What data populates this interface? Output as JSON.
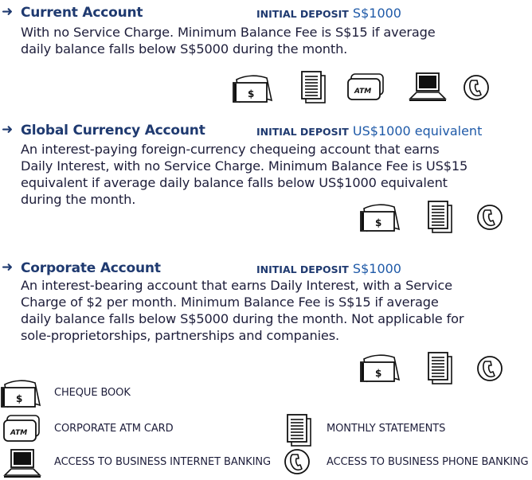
{
  "accounts": [
    {
      "name": "Current Account",
      "deposit_label": "INITIAL DEPOSIT",
      "deposit_value": "S$1000",
      "lines": [
        "With no Service Charge. Minimum Balance Fee is S$15 if average",
        "daily balance falls below S$5000 during the month."
      ],
      "icons": [
        "cheque-book-icon",
        "monthly-statement-icon",
        "atm-card-icon",
        "internet-banking-icon",
        "phone-banking-icon"
      ]
    },
    {
      "name": "Global Currency Account",
      "deposit_label": "INITIAL DEPOSIT",
      "deposit_value": "US$1000 equivalent",
      "lines": [
        "An interest-paying foreign-currency chequeing account that earns",
        "Daily Interest, with no Service Charge. Minimum Balance Fee is US$15",
        "equivalent if average daily balance falls below US$1000 equivalent",
        "during the month."
      ],
      "icons": [
        "cheque-book-icon",
        "monthly-statement-icon",
        "phone-banking-icon"
      ]
    },
    {
      "name": "Corporate Account",
      "deposit_label": "INITIAL DEPOSIT",
      "deposit_value": "S$1000",
      "lines": [
        "An interest-bearing account that earns Daily Interest, with a Service",
        "Charge of $2 per month. Minimum Balance Fee is S$15 if average",
        "daily balance falls below S$5000 during the month. Not applicable for",
        "sole-proprietorships, partnerships and companies."
      ],
      "icons": [
        "cheque-book-icon",
        "monthly-statement-icon",
        "phone-banking-icon"
      ]
    }
  ],
  "legend": {
    "cheque_book": "CHEQUE BOOK",
    "atm_card": "CORPORATE ATM CARD",
    "monthly_statements": "MONTHLY STATEMENTS",
    "internet_banking": "ACCESS TO BUSINESS INTERNET BANKING",
    "phone_banking": "ACCESS TO BUSINESS PHONE BANKING"
  },
  "icon_text": {
    "cheque": "$",
    "atm": "ATM"
  },
  "colors": {
    "heading": "#1f3a70",
    "deposit_value": "#1f5aa8",
    "body_text": "#1d1d3a"
  }
}
